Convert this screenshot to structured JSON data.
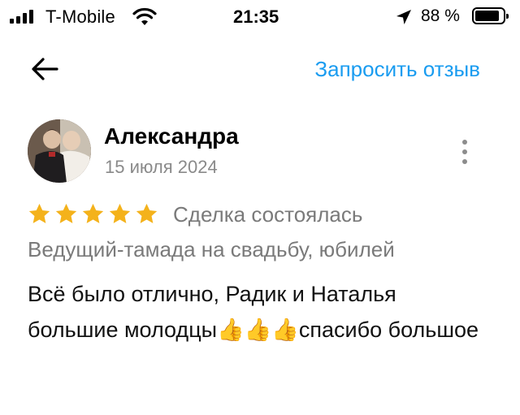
{
  "status_bar": {
    "carrier": "T-Mobile",
    "time": "21:35",
    "battery_percent": "88 %",
    "battery_level": 0.88,
    "icons": [
      "signal-icon",
      "wifi-icon",
      "location-arrow-icon",
      "battery-icon"
    ]
  },
  "nav": {
    "back_icon": "arrow-left-icon",
    "request_review_label": "Запросить отзыв"
  },
  "review": {
    "author": "Александра",
    "date": "15 июля 2024",
    "rating": 5,
    "rating_max": 5,
    "deal_status": "Сделка состоялась",
    "service": "Ведущий-тамада на свадьбу, юбилей",
    "text": "Всё было отлично, Радик и Наталья большие молодцы👍👍👍спасибо большое"
  },
  "colors": {
    "accent": "#1a9cf0",
    "star": "#f4b21b",
    "secondary_text": "#7a7a7a"
  }
}
